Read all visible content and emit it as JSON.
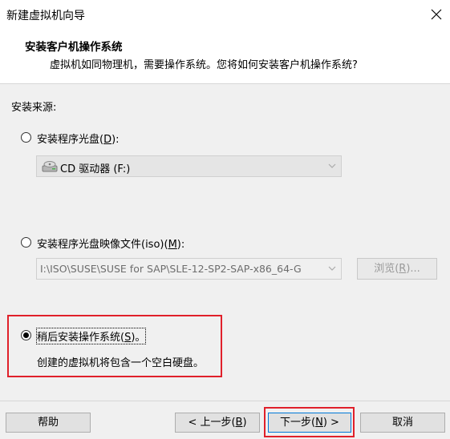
{
  "window": {
    "title": "新建虚拟机向导",
    "close_icon": "close-icon"
  },
  "header": {
    "title": "安装客户机操作系统",
    "description": "虚拟机如同物理机，需要操作系统。您将如何安装客户机操作系统?"
  },
  "source": {
    "label": "安装来源:",
    "disc_option": {
      "label_prefix": "安装程序光盘(",
      "mnemonic": "D",
      "label_suffix": "):",
      "selected": false
    },
    "disc_drive": {
      "value": "CD 驱动器 (F:)",
      "icon": "cd-drive-icon"
    },
    "iso_option": {
      "label_prefix": "安装程序光盘映像文件(iso)(",
      "mnemonic": "M",
      "label_suffix": "):",
      "selected": false
    },
    "iso_path": {
      "value": "I:\\ISO\\SUSE\\SUSE for SAP\\SLE-12-SP2-SAP-x86_64-G"
    },
    "browse": {
      "label_prefix": "浏览(",
      "mnemonic": "R",
      "label_suffix": ")..."
    },
    "later_option": {
      "label_prefix": "稍后安装操作系统(",
      "mnemonic": "S",
      "label_suffix": ")。",
      "selected": true,
      "description": "创建的虚拟机将包含一个空白硬盘。"
    }
  },
  "footer": {
    "help": "帮助",
    "back": {
      "label_prefix": "< 上一步(",
      "mnemonic": "B",
      "label_suffix": ")"
    },
    "next": {
      "label_prefix": "下一步(",
      "mnemonic": "N",
      "label_suffix": ") >"
    },
    "cancel": "取消"
  },
  "colors": {
    "highlight_box": "#e0202a",
    "dialog_background": "#f0f0f0",
    "primary_border": "#0078d7"
  }
}
